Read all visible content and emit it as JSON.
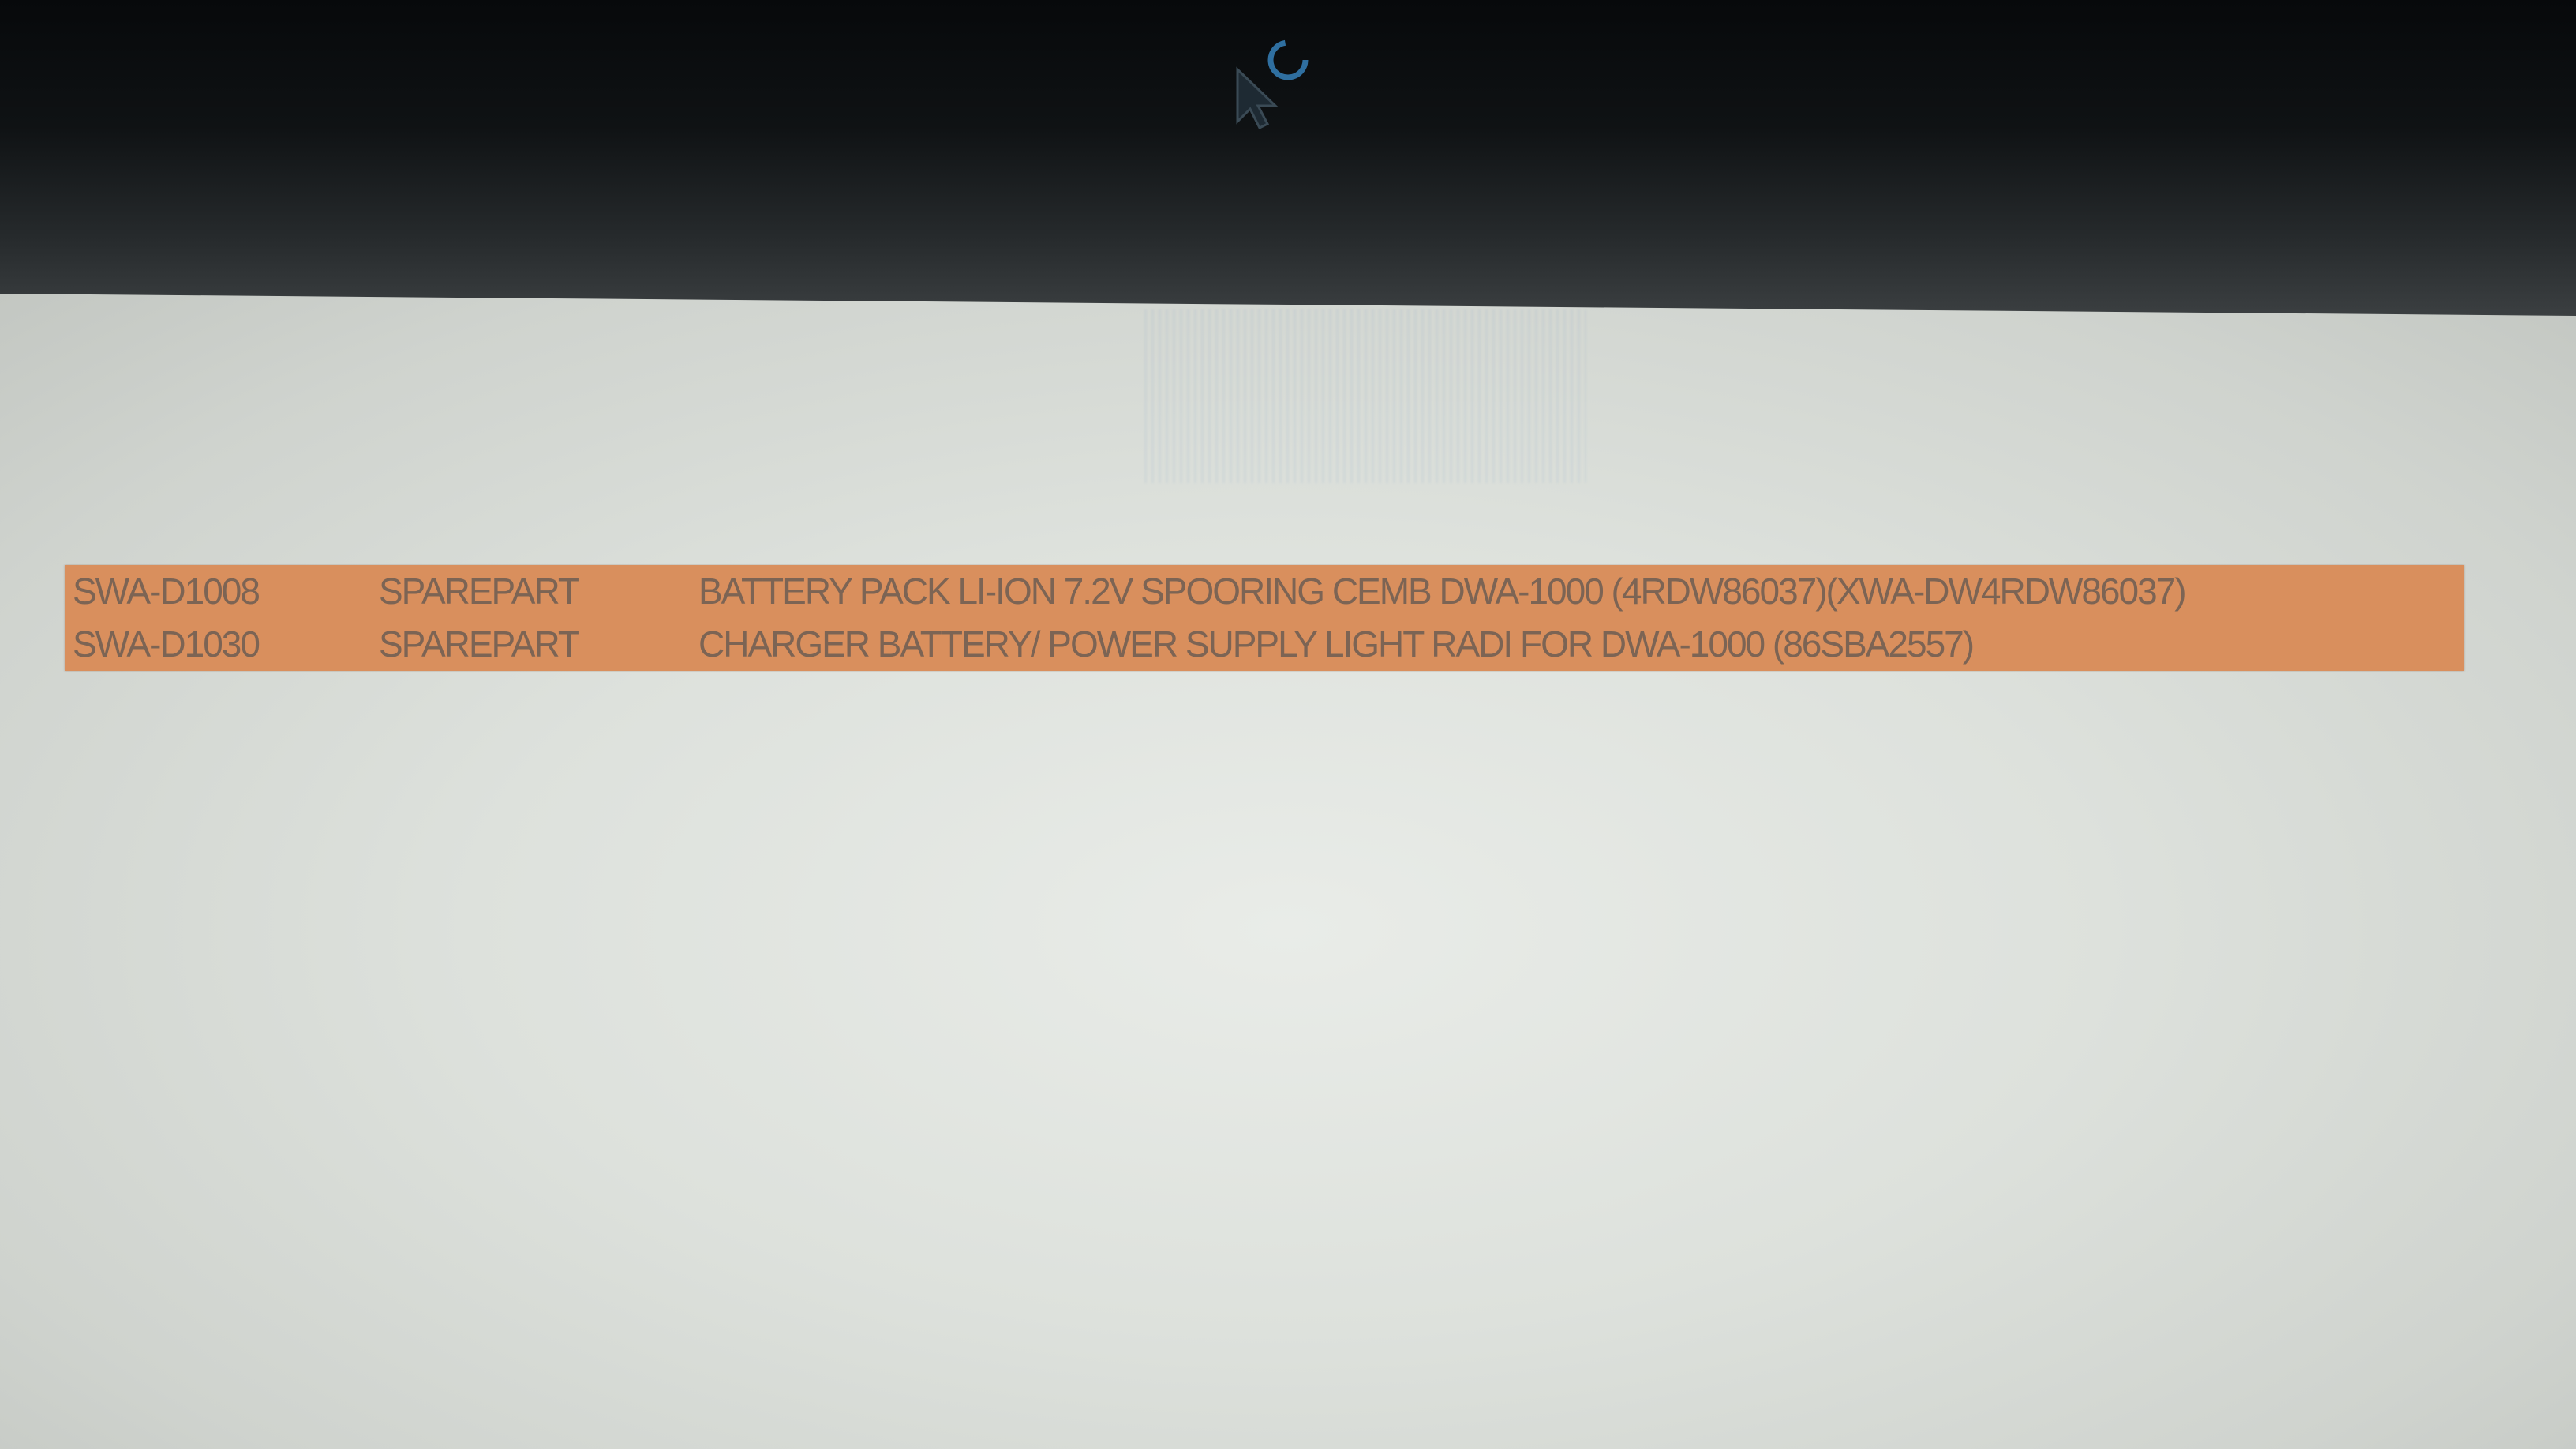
{
  "table": {
    "rows": [
      {
        "code": "SWA-D1008",
        "type": "SPAREPART",
        "description": "BATTERY PACK LI-ION 7.2V SPOORING CEMB DWA-1000 (4RDW86037)(XWA-DW4RDW86037)"
      },
      {
        "code": "SWA-D1030",
        "type": "SPAREPART",
        "description": "CHARGER BATTERY/ POWER SUPPLY LIGHT RADI FOR DWA-1000 (86SBA2557)"
      }
    ]
  },
  "icons": {
    "cursor": "busy-cursor-icon"
  },
  "colors": {
    "row_highlight": "#d98f5d",
    "row_text": "#7c6454",
    "screen": "#dde1dc"
  }
}
